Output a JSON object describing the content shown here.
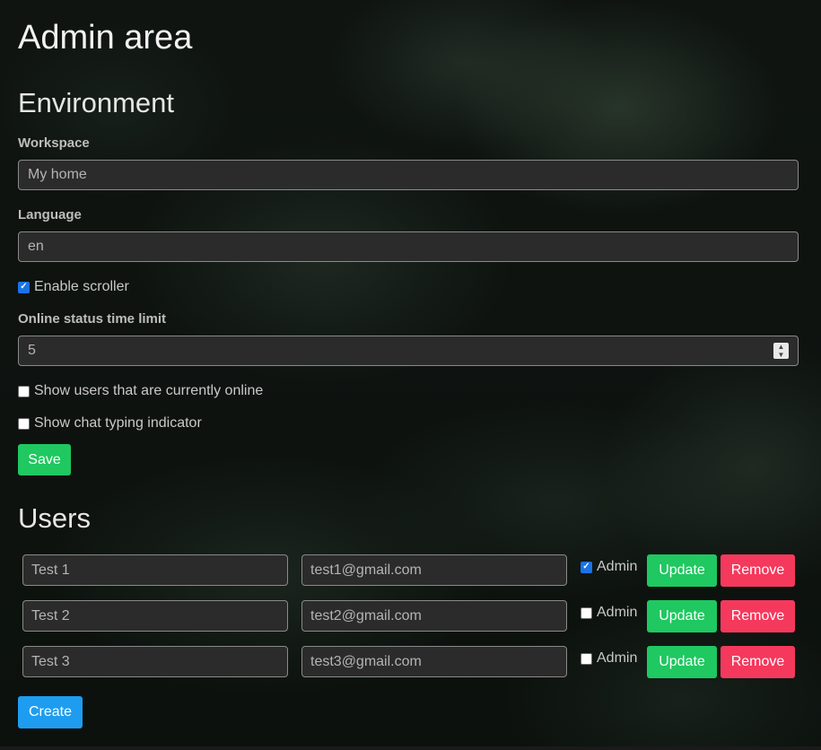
{
  "page": {
    "title": "Admin area"
  },
  "environment": {
    "heading": "Environment",
    "workspace_label": "Workspace",
    "workspace_value": "My home",
    "language_label": "Language",
    "language_value": "en",
    "enable_scroller_label": "Enable scroller",
    "enable_scroller_checked": true,
    "online_limit_label": "Online status time limit",
    "online_limit_value": "5",
    "show_online_label": "Show users that are currently online",
    "show_online_checked": false,
    "show_typing_label": "Show chat typing indicator",
    "show_typing_checked": false,
    "save_label": "Save"
  },
  "users": {
    "heading": "Users",
    "admin_label": "Admin",
    "update_label": "Update",
    "remove_label": "Remove",
    "create_label": "Create",
    "rows": [
      {
        "name": "Test 1",
        "email": "test1@gmail.com",
        "admin": true
      },
      {
        "name": "Test 2",
        "email": "test2@gmail.com",
        "admin": false
      },
      {
        "name": "Test 3",
        "email": "test3@gmail.com",
        "admin": false
      }
    ]
  },
  "colors": {
    "green": "#1fc860",
    "red": "#f4395d",
    "blue": "#1e9df0",
    "checkbox_blue": "#1a73e8"
  },
  "icons": {
    "checkmark": "check-icon",
    "spinner": "number-spinner-icon"
  }
}
